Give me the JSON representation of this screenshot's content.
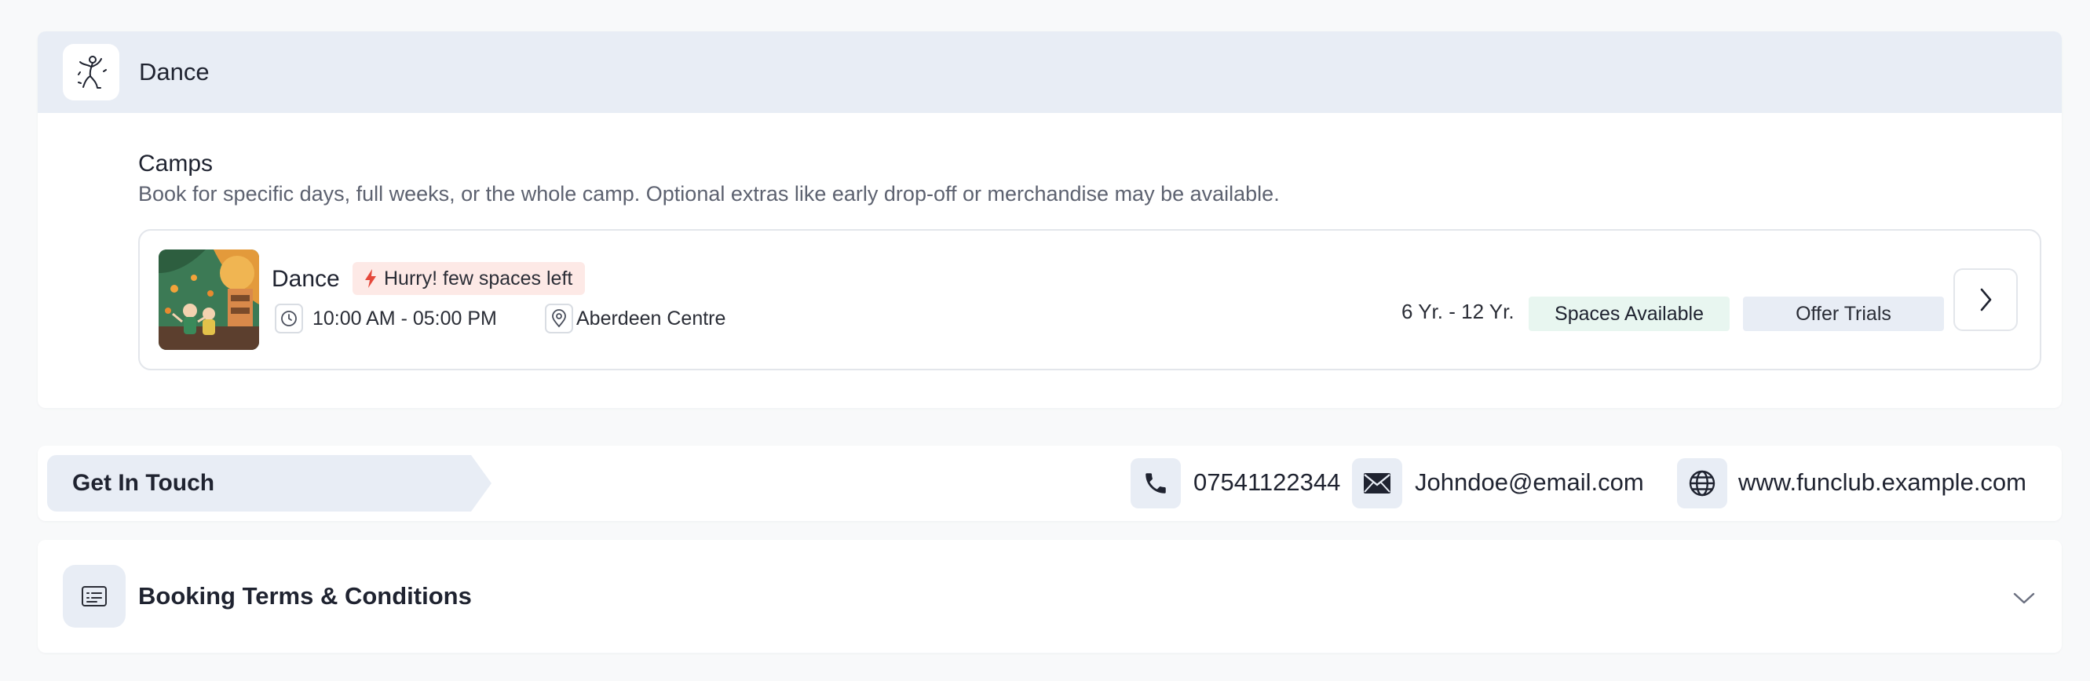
{
  "category": {
    "title": "Dance",
    "icon": "dancer-icon"
  },
  "section": {
    "title": "Camps",
    "description": "Book for specific days, full weeks, or the whole camp. Optional extras like early drop-off or merchandise may be available."
  },
  "camp": {
    "name": "Dance",
    "urgency": "Hurry! few spaces left",
    "time": "10:00 AM - 05:00 PM",
    "location": "Aberdeen Centre",
    "age_range": "6 Yr. - 12 Yr.",
    "availability": "Spaces Available",
    "trials": "Offer Trials"
  },
  "contact": {
    "heading": "Get In Touch",
    "phone": "07541122344",
    "email": "Johndoe@email.com",
    "website": "www.funclub.example.com"
  },
  "terms": {
    "title": "Booking Terms & Conditions"
  },
  "colors": {
    "header_bg": "#e8edf5",
    "urgency_bg": "#fde9e6",
    "urgency_icon": "#e5483b",
    "available_bg": "#e8f6f0",
    "muted_text": "#5d6270"
  }
}
